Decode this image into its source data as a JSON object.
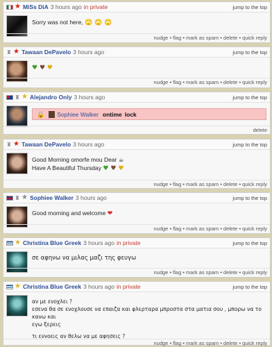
{
  "common": {
    "jump": "jump to the top",
    "actions": "nudge • flag • mark as spam • delete • quick reply",
    "delete_only": "delete"
  },
  "posts": [
    {
      "user": "MiSs DiA",
      "time": "3 hours ago",
      "private": "in private",
      "flag": "mexico-flag",
      "star": "red-star-icon",
      "lines": [
        "Sorry was not here,"
      ],
      "emoji": "🙄 🙄 🙄"
    },
    {
      "user": "Tawaan DePavelo",
      "time": "3 hours ago",
      "private": "",
      "flag": "",
      "star": "red-star-icon",
      "lines": [
        ""
      ],
      "emoji": "💚 🤎 💛"
    },
    {
      "user": "Alejandro Only",
      "time": "3 hours ago",
      "private": "",
      "flag": "australia-flag",
      "star": "gold-star-icon",
      "lock": {
        "user": "Sophiee Walker",
        "ontime": "ontime",
        "lock": "lock"
      }
    },
    {
      "user": "Tawaan DePavelo",
      "time": "3 hours ago",
      "private": "",
      "flag": "",
      "star": "red-star-icon",
      "lines": [
        "Good Morning omorfe mou Dear ☕",
        "Have A Beautiful Thursday"
      ],
      "emoji": "💚 🤎 💛"
    },
    {
      "user": "Sophiee Walker",
      "time": "3 hours ago",
      "private": "",
      "flag": "uk-flag",
      "star": "grey-star-icon",
      "lines": [
        "Good morning and welcome"
      ],
      "emoji": "❤"
    },
    {
      "user": "Christina Blue Greek",
      "time": "3 hours ago",
      "private": "in private",
      "flag": "greece-flag",
      "star": "gold-star-icon",
      "lines": [
        "σε αφηνω να μιλας μαζι της φευγω"
      ]
    },
    {
      "user": "Christina Blue Greek",
      "time": "3 hours ago",
      "private": "in private",
      "flag": "greece-flag",
      "star": "gold-star-icon",
      "lines": [
        "αν με ενοχλει ?",
        "εσενα θα σε ενοχλουσε να επαιζα και φλερταρα μπροστα στα ματια σου , μπορω να το κανω και",
        "εγω ξερεις",
        "",
        "τι εννοεις αν θελω να με αφησεις ?"
      ]
    }
  ],
  "colors": {
    "username": "#2f4f96",
    "private": "#c0392b",
    "lock_bg": "#f9c4c4"
  }
}
